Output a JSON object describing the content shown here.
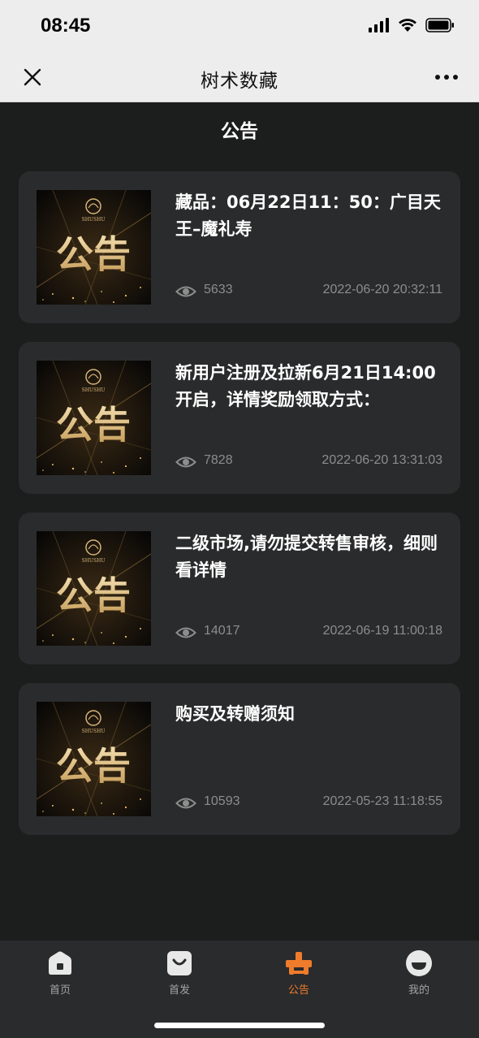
{
  "status_bar": {
    "time": "08:45"
  },
  "nav": {
    "title": "树术数藏"
  },
  "page": {
    "title": "公告"
  },
  "thumbnail": {
    "logo_text": "SHUSHU",
    "big_text": "公告"
  },
  "notices": [
    {
      "title": "藏品：06月22日11：50：广目天王–魔礼寿",
      "views": "5633",
      "date": "2022-06-20 20:32:11"
    },
    {
      "title": "新用户注册及拉新6月21日14:00开启，详情奖励领取方式：",
      "views": "7828",
      "date": "2022-06-20 13:31:03"
    },
    {
      "title": "二级市场,请勿提交转售审核，细则看详情",
      "views": "14017",
      "date": "2022-06-19 11:00:18"
    },
    {
      "title": "购买及转赠须知",
      "views": "10593",
      "date": "2022-05-23 11:18:55"
    }
  ],
  "tabs": [
    {
      "label": "首页",
      "icon": "home-icon"
    },
    {
      "label": "首发",
      "icon": "bag-icon"
    },
    {
      "label": "公告",
      "icon": "announcement-icon",
      "active": true
    },
    {
      "label": "我的",
      "icon": "profile-icon"
    }
  ],
  "colors": {
    "accent": "#ef7c2c",
    "background": "#1c1d1d",
    "card": "#2a2b2c"
  }
}
